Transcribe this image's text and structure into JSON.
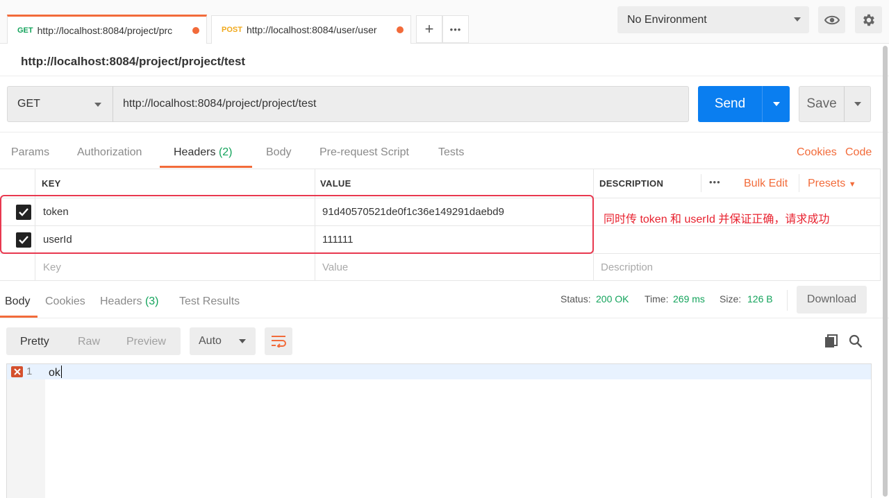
{
  "tabs": [
    {
      "method": "GET",
      "url": "http://localhost:8084/project/prc"
    },
    {
      "method": "POST",
      "url": "http://localhost:8084/user/user"
    }
  ],
  "tab_actions": {
    "new_tab": "+",
    "more": "•••"
  },
  "environment": {
    "selected": "No Environment"
  },
  "request": {
    "title": "http://localhost:8084/project/project/test",
    "method": "GET",
    "url": "http://localhost:8084/project/project/test",
    "send_label": "Send",
    "save_label": "Save"
  },
  "request_tabs": {
    "params": "Params",
    "authorization": "Authorization",
    "headers": "Headers",
    "headers_count": "(2)",
    "body": "Body",
    "prerequest": "Pre-request Script",
    "tests": "Tests",
    "cookies": "Cookies",
    "code": "Code"
  },
  "headers_table": {
    "columns": {
      "key": "KEY",
      "value": "VALUE",
      "description": "DESCRIPTION"
    },
    "more": "•••",
    "bulk_edit": "Bulk Edit",
    "presets": "Presets",
    "rows": [
      {
        "checked": true,
        "key": "token",
        "value": "91d40570521de0f1c36e149291daebd9"
      },
      {
        "checked": true,
        "key": "userId",
        "value": "111111"
      }
    ],
    "placeholders": {
      "key": "Key",
      "value": "Value",
      "description": "Description"
    }
  },
  "annotation": "同时传 token 和 userId 并保证正确，请求成功",
  "response": {
    "tabs": {
      "body": "Body",
      "cookies": "Cookies",
      "headers": "Headers",
      "headers_count": "(3)",
      "test_results": "Test Results"
    },
    "status_label": "Status:",
    "status_value": "200 OK",
    "time_label": "Time:",
    "time_value": "269 ms",
    "size_label": "Size:",
    "size_value": "126 B",
    "download_label": "Download",
    "formats": {
      "pretty": "Pretty",
      "raw": "Raw",
      "preview": "Preview"
    },
    "language": "Auto",
    "lines": [
      {
        "number": "1",
        "text": "ok"
      }
    ]
  },
  "colors": {
    "accent": "#f26b3a",
    "send_blue": "#0a7ef0",
    "success_green": "#13a35b",
    "annotation_red": "#e8384f"
  }
}
